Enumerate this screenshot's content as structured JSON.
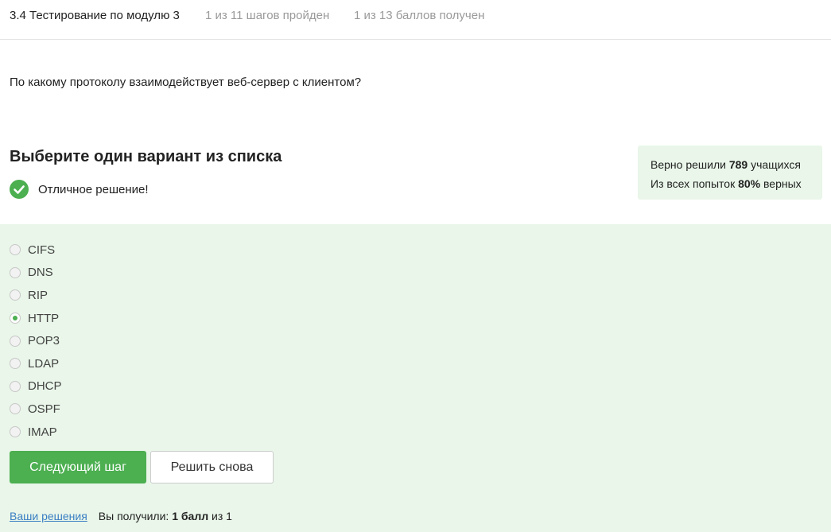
{
  "header": {
    "lesson_title": "3.4 Тестирование по модулю 3",
    "steps_progress": "1 из 11 шагов пройден",
    "points_progress": "1 из 13 баллов  получен"
  },
  "question": "По какому протоколу взаимодействует веб-сервер с клиентом?",
  "choose_title": "Выберите один вариант из списка",
  "result": {
    "icon": "check-circle-icon",
    "color": "#4caf50",
    "text": "Отличное решение!"
  },
  "stats": {
    "line1_prefix": "Верно решили ",
    "solved_count": "789",
    "line1_suffix": " учащихся",
    "line2_prefix": "Из всех попыток ",
    "percent": "80%",
    "line2_suffix": " верных"
  },
  "options": [
    {
      "label": "CIFS",
      "checked": false
    },
    {
      "label": "DNS",
      "checked": false
    },
    {
      "label": "RIP",
      "checked": false
    },
    {
      "label": "HTTP",
      "checked": true
    },
    {
      "label": "POP3",
      "checked": false
    },
    {
      "label": "LDAP",
      "checked": false
    },
    {
      "label": "DHCP",
      "checked": false
    },
    {
      "label": "OSPF",
      "checked": false
    },
    {
      "label": "IMAP",
      "checked": false
    }
  ],
  "buttons": {
    "next": "Следующий шаг",
    "retry": "Решить снова"
  },
  "footer": {
    "solutions_link": "Ваши решения",
    "score_prefix": "Вы получили: ",
    "score_value": "1 балл",
    "score_suffix": " из 1"
  },
  "colors": {
    "accent": "#4caf50",
    "panel_bg": "#e9f6e9",
    "link": "#3b7fc4",
    "muted": "#9a9a9a"
  }
}
